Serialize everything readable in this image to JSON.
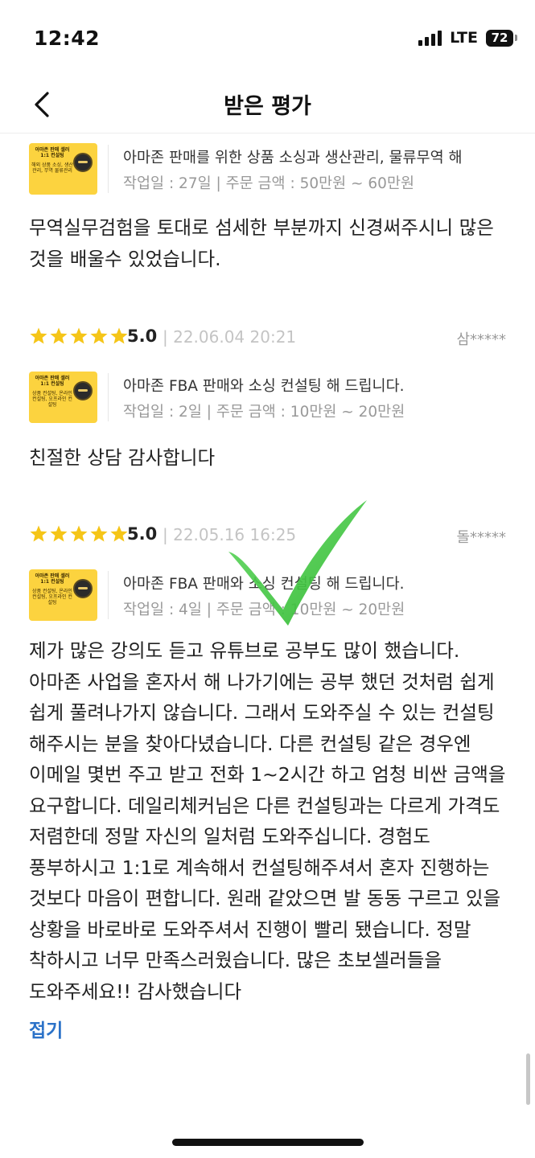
{
  "status_bar": {
    "time": "12:42",
    "network": "LTE",
    "battery": "72"
  },
  "header": {
    "title": "받은 평가",
    "back_icon": "chevron-left-icon"
  },
  "reviews": [
    {
      "rating": "",
      "date": "",
      "reviewer": "",
      "thumb": {
        "line1": "아마존 판매 셀러 1:1 컨설팅",
        "line2": "해외 상품 소싱, 생산관리, 무역 물류관리",
        "sig": ""
      },
      "product_title": "아마존 판매를 위한 상품 소싱과 생산관리, 물류무역 해",
      "meta": "작업일 : 27일 | 주문 금액 : 50만원 ~ 60만원",
      "comment": "무역실무검험을 토대로 섬세한 부분까지 신경써주시니 많은 것을 배울수 있었습니다."
    },
    {
      "rating": "5.0",
      "date": "| 22.06.04 20:21",
      "reviewer": "삼*****",
      "thumb": {
        "line1": "아마존 판매 셀러 1:1 컨설팅",
        "line2": "상품 컨설팅, 온라인 컨설팅, 오프라인 컨설팅",
        "sig": ""
      },
      "product_title": "아마존 FBA 판매와 소싱 컨설팅 해 드립니다.",
      "meta": "작업일 : 2일 | 주문 금액 : 10만원 ~ 20만원",
      "comment": "친절한 상담 감사합니다"
    },
    {
      "rating": "5.0",
      "date": "| 22.05.16 16:25",
      "reviewer": "돌*****",
      "thumb": {
        "line1": "아마존 판매 셀러 1:1 컨설팅",
        "line2": "상품 컨설팅, 온라인 컨설팅, 오프라인 컨설팅",
        "sig": ""
      },
      "product_title": "아마존 FBA 판매와 소싱 컨설팅 해 드립니다.",
      "meta": "작업일 : 4일 | 주문 금액 : 10만원 ~ 20만원",
      "comment": "제가 많은 강의도 듣고 유튜브로 공부도 많이 했습니다. 아마존 사업을 혼자서 해 나가기에는 공부 했던 것처럼 쉽게 쉽게 풀려나가지 않습니다. 그래서 도와주실 수 있는 컨설팅 해주시는 분을 찾아다녔습니다. 다른 컨설팅 같은 경우엔 이메일 몇번 주고 받고 전화 1~2시간 하고 엄청 비싼 금액을 요구합니다. 데일리체커님은 다른 컨설팅과는 다르게 가격도 저렴한데 정말 자신의 일처럼 도와주십니다.  경험도 풍부하시고 1:1로 계속해서 컨설팅해주셔서 혼자 진행하는 것보다 마음이 편합니다. 원래 같았으면 발 동동 구르고 있을 상황을 바로바로 도와주셔서 진행이 빨리 됐습니다.  정말 착하시고 너무 만족스러웠습니다. 많은 초보셀러들을 도와주세요!! 감사했습니다",
      "fold_label": "접기"
    }
  ],
  "colors": {
    "star": "#f5c518",
    "link": "#2b72c8",
    "checkmark": "#3bc43b",
    "thumb_bg": "#fcd33f"
  }
}
